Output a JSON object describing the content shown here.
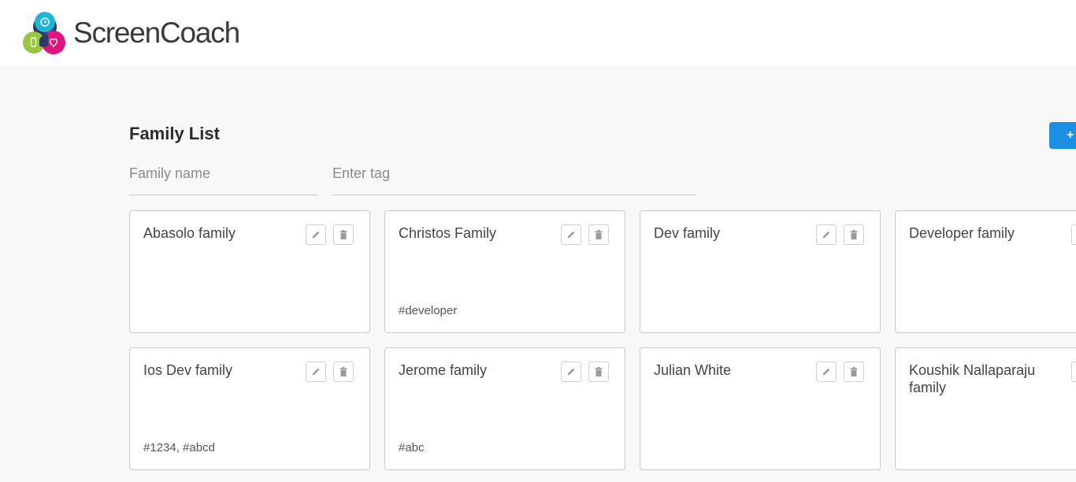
{
  "app": {
    "brand": "ScreenCoach"
  },
  "page": {
    "title": "Family List",
    "add_label": "+"
  },
  "filters": {
    "name_placeholder": "Family name",
    "tag_placeholder": "Enter tag"
  },
  "families": [
    {
      "name": "Abasolo family",
      "tags": ""
    },
    {
      "name": "Christos Family",
      "tags": "#developer"
    },
    {
      "name": "Dev family",
      "tags": ""
    },
    {
      "name": "Developer family",
      "tags": ""
    },
    {
      "name": "Ios Dev family",
      "tags": "#1234, #abcd"
    },
    {
      "name": "Jerome family",
      "tags": "#abc"
    },
    {
      "name": "Julian White",
      "tags": ""
    },
    {
      "name": "Koushik Nallaparaju family",
      "tags": ""
    }
  ],
  "colors": {
    "accent": "#1a8fe3",
    "logo_cyan": "#1fb6d6",
    "logo_green": "#9ac63f",
    "logo_magenta": "#e0147d",
    "logo_navy": "#2b3a67"
  },
  "icons": {
    "edit": "pencil-icon",
    "delete": "trash-icon"
  }
}
